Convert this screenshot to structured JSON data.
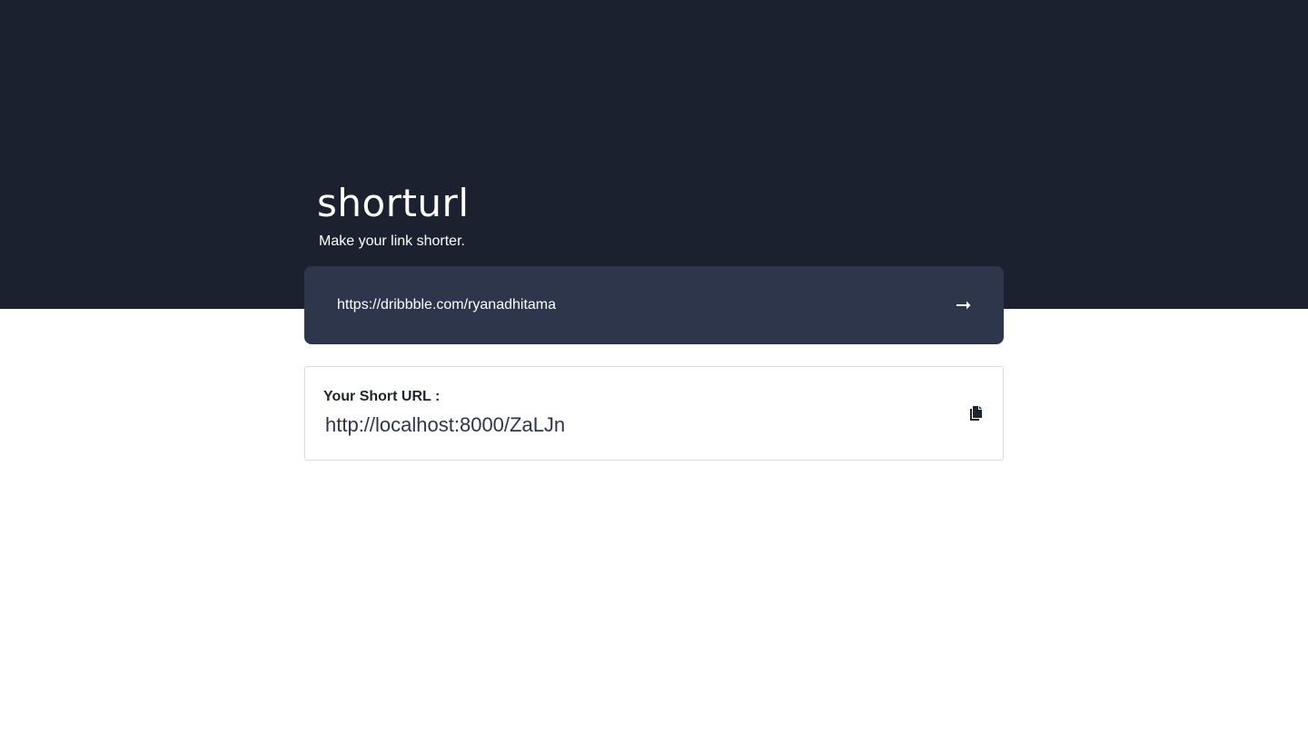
{
  "header": {
    "title": "shorturl",
    "tagline": "Make your link shorter."
  },
  "form": {
    "input_value": "https://dribbble.com/ryanadhitama",
    "submit_icon": "arrow-right-icon"
  },
  "result": {
    "label": "Your Short URL :",
    "short_url": "http://localhost:8000/ZaLJn",
    "copy_icon": "copy-icon"
  },
  "colors": {
    "hero_background": "#1c2130",
    "form_background": "#2d364b",
    "text_light": "#ffffff",
    "text_dark": "#1f2430",
    "card_border": "#dcdcdc"
  }
}
